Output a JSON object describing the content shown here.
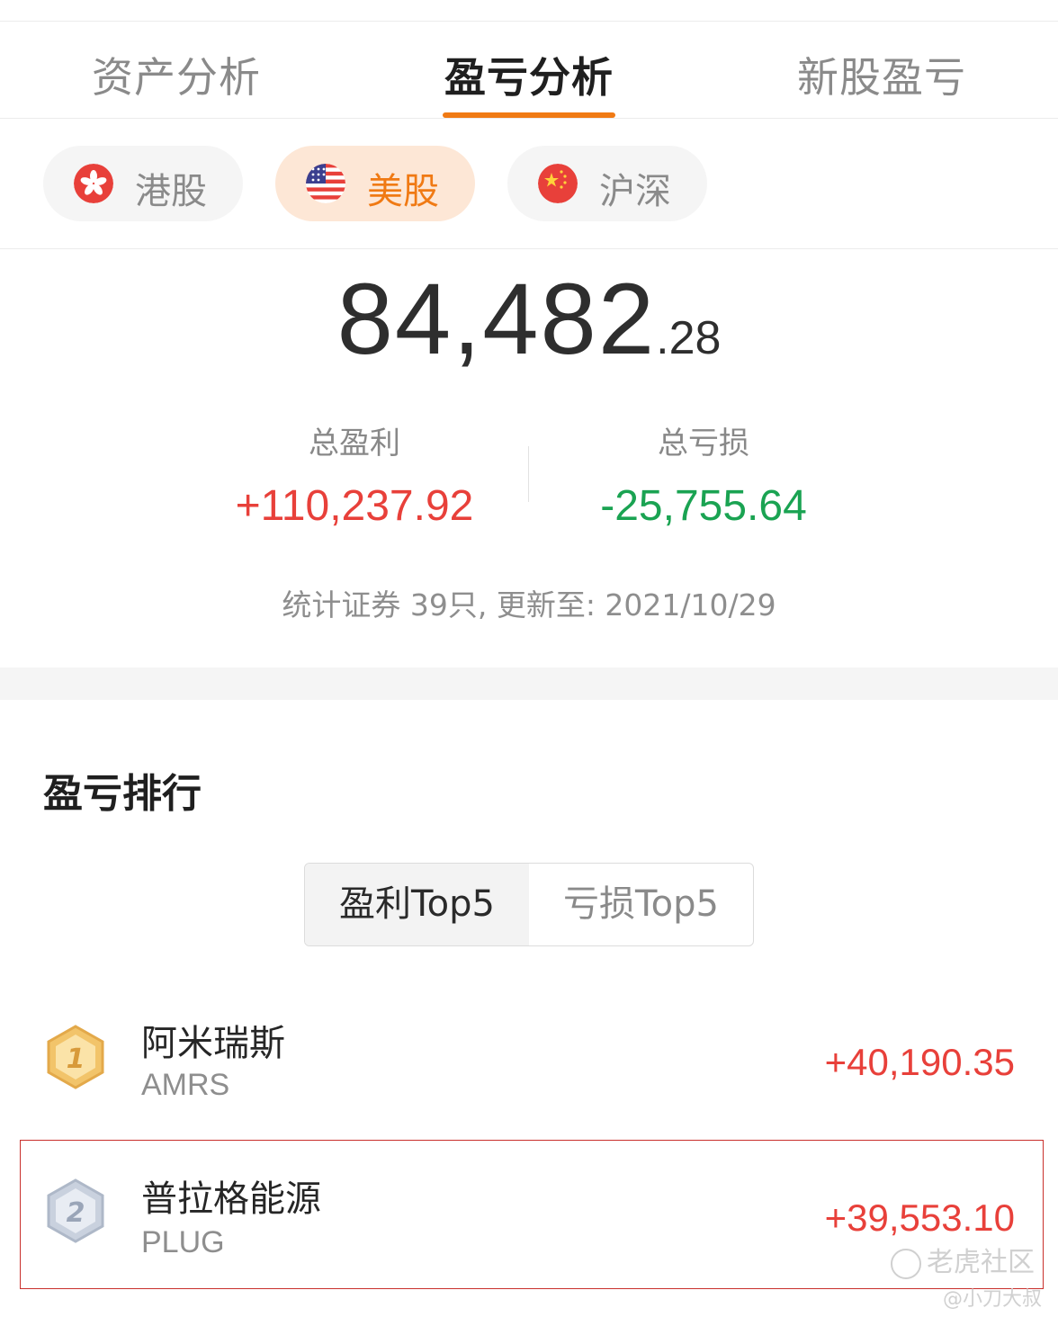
{
  "main_tabs": [
    {
      "label": "资产分析",
      "active": false
    },
    {
      "label": "盈亏分析",
      "active": true
    },
    {
      "label": "新股盈亏",
      "active": false
    }
  ],
  "accent_color": "#f07a14",
  "markets": [
    {
      "label": "港股",
      "icon": "hk-flag-icon",
      "active": false
    },
    {
      "label": "美股",
      "icon": "us-flag-icon",
      "active": true
    },
    {
      "label": "沪深",
      "icon": "cn-flag-icon",
      "active": false
    }
  ],
  "summary": {
    "total_int": "84,482",
    "total_dec": ".28",
    "profit_label": "总盈利",
    "profit_value": "+110,237.92",
    "loss_label": "总亏损",
    "loss_value": "-25,755.64",
    "footnote": "统计证券 39只, 更新至: 2021/10/29"
  },
  "colors": {
    "profit": "#e8403a",
    "loss": "#1aa352"
  },
  "ranking": {
    "title": "盈亏排行",
    "toggle": {
      "profit_label": "盈利Top5",
      "loss_label": "亏损Top5",
      "active": "profit"
    },
    "items": [
      {
        "rank": "1",
        "name": "阿米瑞斯",
        "code": "AMRS",
        "pnl": "+40,190.35"
      },
      {
        "rank": "2",
        "name": "普拉格能源",
        "code": "PLUG",
        "pnl": "+39,553.10"
      }
    ]
  },
  "watermark": {
    "brand": "老虎社区",
    "user": "@小刀大叔"
  }
}
